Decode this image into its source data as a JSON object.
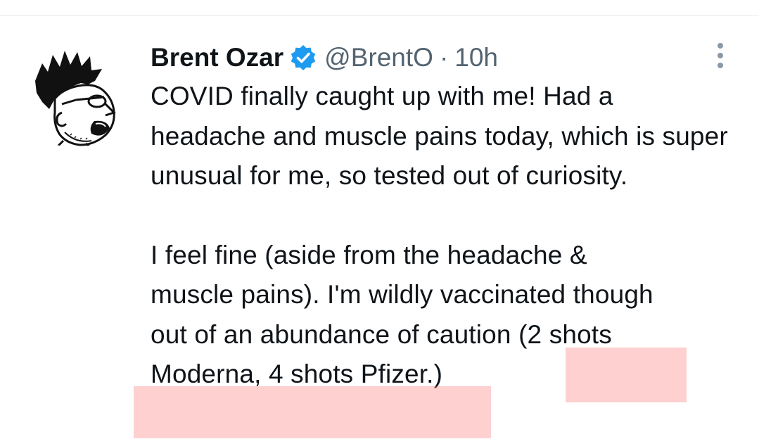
{
  "tweet": {
    "display_name": "Brent Ozar",
    "handle": "@BrentO",
    "separator": "·",
    "time": "10h",
    "paragraph_1": "COVID finally caught up with me! Had a headache and muscle pains today, which is super unusual for me, so tested out of curiosity.",
    "paragraph_2_lines": [
      "I feel fine (aside from the headache &",
      "muscle pains). I'm wildly vaccinated though",
      "out of an abundance of caution ",
      "(2 shots",
      "Moderna, 4 shots Pfizer.)"
    ]
  },
  "icons": {
    "verified": "verified-badge-icon",
    "more": "more-options-icon",
    "avatar": "caricature-avatar"
  },
  "colors": {
    "verified_blue": "#1d9bf0",
    "secondary_text": "#536471",
    "highlight": "#ff6e6e"
  }
}
